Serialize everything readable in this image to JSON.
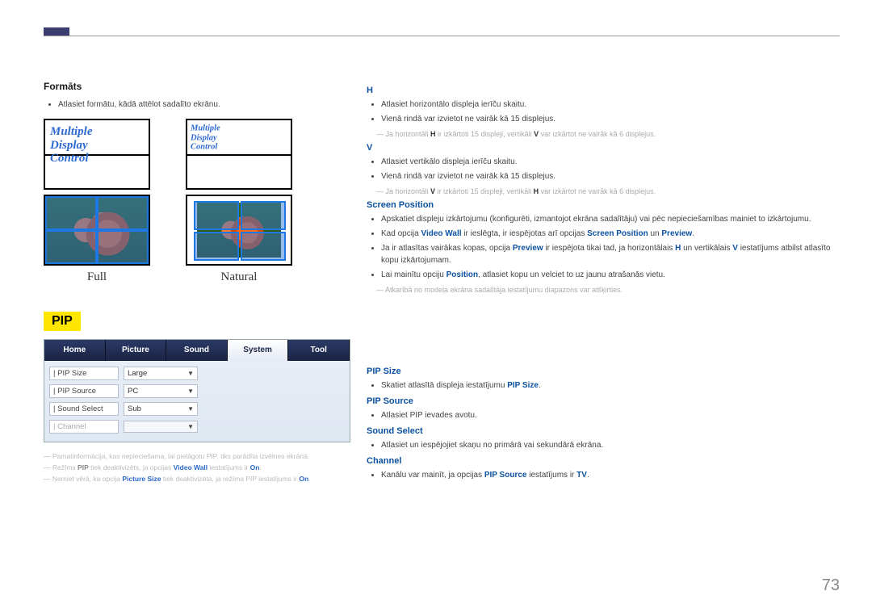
{
  "page_number": "73",
  "left": {
    "formats_heading": "Formāts",
    "formats_bullet": "Atlasiet formātu, kādā attēlot sadalīto ekrānu.",
    "mdc_text": "Multiple\nDisplay\nControl",
    "label_full": "Full",
    "label_natural": "Natural",
    "pip_badge": "PIP",
    "pip_tabs": [
      "Home",
      "Picture",
      "Sound",
      "System",
      "Tool"
    ],
    "pip_rows": [
      {
        "label": "PIP Size",
        "value": "Large",
        "dim": false
      },
      {
        "label": "PIP Source",
        "value": "PC",
        "dim": false
      },
      {
        "label": "Sound Select",
        "value": "Sub",
        "dim": false
      },
      {
        "label": "Channel",
        "value": "",
        "dim": true
      }
    ],
    "notes": [
      {
        "text": "Pamatinformācija, kas nepieciešama, lai pielāgotu PIP, tiks parādīta izvēlnes ekrānā."
      },
      {
        "parts": [
          {
            "t": "Režīms "
          },
          {
            "t": "PIP",
            "b": true
          },
          {
            "t": " tiek deaktivizēts, ja opcijas "
          },
          {
            "t": "Video Wall",
            "bb": true
          },
          {
            "t": " iestatījums ir "
          },
          {
            "t": "On",
            "bb": true
          },
          {
            "t": "."
          }
        ]
      },
      {
        "parts": [
          {
            "t": "Ņemiet vērā, ka opcija "
          },
          {
            "t": "Picture Size",
            "bb": true
          },
          {
            "t": " tiek deaktivizēta, ja režīma PIP iestatījums ir "
          },
          {
            "t": "On",
            "bb": true
          },
          {
            "t": "."
          }
        ]
      }
    ]
  },
  "right": {
    "sections": [
      {
        "head": "H",
        "bullets": [
          [
            {
              "t": "Atlasiet horizontālo displeja ierīču skaitu."
            }
          ],
          [
            {
              "t": "Vienā rindā var izvietot ne vairāk kā 15 displejus."
            }
          ]
        ],
        "footnote": [
          {
            "t": "Ja horizontāli "
          },
          {
            "t": "H",
            "b": true
          },
          {
            "t": " ir izkārtoti 15 displeji, vertikāli "
          },
          {
            "t": "V",
            "b": true
          },
          {
            "t": " var izkārtot ne vairāk kā 6 displejus."
          }
        ]
      },
      {
        "head": "V",
        "bullets": [
          [
            {
              "t": "Atlasiet vertikālo displeja ierīču skaitu."
            }
          ],
          [
            {
              "t": "Vienā rindā var izvietot ne vairāk kā 15 displejus."
            }
          ]
        ],
        "footnote": [
          {
            "t": "Ja horizontāli "
          },
          {
            "t": "V",
            "b": true
          },
          {
            "t": " ir izkārtoti 15 displeji, vertikāli "
          },
          {
            "t": "H",
            "b": true
          },
          {
            "t": " var izkārtot ne vairāk kā 6 displejus."
          }
        ]
      },
      {
        "head": "Screen Position",
        "bullets": [
          [
            {
              "t": "Apskatiet displeju izkārtojumu (konfigurēti, izmantojot ekrāna sadalītāju) vai pēc nepieciešamības mainiet to izkārtojumu."
            }
          ],
          [
            {
              "t": "Kad opcija "
            },
            {
              "t": "Video Wall",
              "bb": true
            },
            {
              "t": " ir ieslēgta, ir iespējotas arī opcijas "
            },
            {
              "t": "Screen Position",
              "bb": true
            },
            {
              "t": " un "
            },
            {
              "t": "Preview",
              "bb": true
            },
            {
              "t": "."
            }
          ],
          [
            {
              "t": "Ja ir atlasītas vairākas kopas, opcija "
            },
            {
              "t": "Preview",
              "bb": true
            },
            {
              "t": " ir iespējota tikai tad, ja horizontālais "
            },
            {
              "t": "H",
              "bb": true
            },
            {
              "t": " un vertikālais "
            },
            {
              "t": "V",
              "bb": true
            },
            {
              "t": " iestatījums atbilst atlasīto kopu izkārtojumam."
            }
          ],
          [
            {
              "t": "Lai mainītu opciju "
            },
            {
              "t": "Position",
              "bb": true
            },
            {
              "t": ", atlasiet kopu un velciet to uz jaunu atrašanās vietu."
            }
          ]
        ],
        "footnote": [
          {
            "t": "Atkarībā no modeļa ekrāna sadalītāja iestatījumu diapazons var atšķirties."
          }
        ]
      }
    ],
    "pip_sections": [
      {
        "head": "PIP Size",
        "bullets": [
          [
            {
              "t": "Skatiet atlasītā displeja iestatījumu "
            },
            {
              "t": "PIP Size",
              "bb": true
            },
            {
              "t": "."
            }
          ]
        ]
      },
      {
        "head": "PIP Source",
        "bullets": [
          [
            {
              "t": "Atlasiet PIP ievades avotu."
            }
          ]
        ]
      },
      {
        "head": "Sound Select",
        "bullets": [
          [
            {
              "t": "Atlasiet un iespējojiet skaņu no primārā vai sekundārā ekrāna."
            }
          ]
        ]
      },
      {
        "head": "Channel",
        "bullets": [
          [
            {
              "t": "Kanālu var mainīt, ja opcijas "
            },
            {
              "t": "PIP Source",
              "bb": true
            },
            {
              "t": " iestatījums ir "
            },
            {
              "t": "TV",
              "bb": true
            },
            {
              "t": "."
            }
          ]
        ]
      }
    ]
  }
}
